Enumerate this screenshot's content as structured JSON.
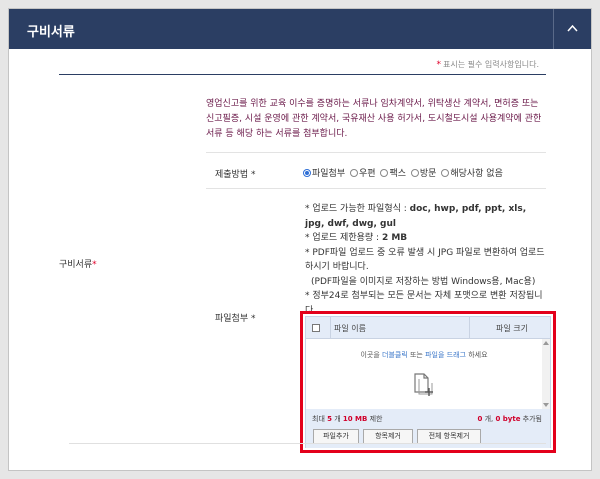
{
  "header": {
    "title": "구비서류",
    "collapse_icon": "chevron-up-icon"
  },
  "required_note": {
    "star": "*",
    "text": "표시는 필수 입력사항입니다."
  },
  "section": {
    "label": "구비서류",
    "star": "*"
  },
  "intro": "영업신고를 위한 교육 이수를 증명하는 서류나 임차계약서, 위탁생산 계약서, 면허증 또는 신고필증, 시설 운영에 관한 계약서, 국유재산 사용 허가서, 도시철도시설 사용계약에 관한 서류 등 해당 하는 서류를 첨부합니다.",
  "submit_method": {
    "label": "제출방법 *",
    "options": [
      {
        "label": "파일첨부",
        "selected": true
      },
      {
        "label": "우편",
        "selected": false
      },
      {
        "label": "팩스",
        "selected": false
      },
      {
        "label": "방문",
        "selected": false
      },
      {
        "label": "해당사항 없음",
        "selected": false
      }
    ]
  },
  "attach": {
    "label": "파일첨부 *",
    "info": {
      "formats_prefix": "* 업로드 가능한 파일형식 : ",
      "formats": "doc, hwp, pdf, ppt, xls, jpg, dwf, dwg, gul",
      "limit_prefix": "* 업로드 제한용량 : ",
      "limit": "2 MB",
      "pdf_note": "* PDF파일 업로드 중 오류 발생 시 JPG 파일로 변환하여 업로드 하시기 바랍니다.",
      "pdf_method": "(PDF파일을 이미지로 저장하는 방법  Windows용, Mac용)",
      "gov_note": "* 정부24로 첨부되는 모든 문서는 자체 포맷으로 변환 저장됩니다."
    }
  },
  "uploader": {
    "col_name": "파일 이름",
    "col_size": "파일 크기",
    "hint_pre": "이곳을 ",
    "hint_click": "더블클릭",
    "hint_mid": " 또는 ",
    "hint_drag": "파일을 드래그",
    "hint_post": " 하세요",
    "status_max_pre": "최대 ",
    "status_max_count": "5",
    "status_max_mid": " 개 ",
    "status_max_size": "10 MB",
    "status_max_post": " 제한",
    "status_cur_count": "0",
    "status_cur_mid": " 개, ",
    "status_cur_size": "0 byte",
    "status_cur_post": " 추가됨",
    "btn_add": "파일추가",
    "btn_remove": "항목제거",
    "btn_remove_all": "전체 항목제거"
  },
  "colors": {
    "header_bg": "#2b3e63",
    "highlight": "#e3001b",
    "required": "#e0002a",
    "intro_text": "#6b1a4a"
  }
}
